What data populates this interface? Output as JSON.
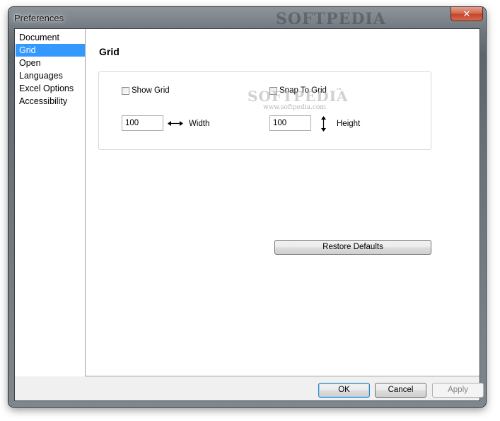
{
  "window": {
    "title": "Preferences",
    "close_glyph": "✕",
    "watermark": "SOFTPEDIA"
  },
  "sidebar": {
    "items": [
      {
        "label": "Document",
        "selected": false
      },
      {
        "label": "Grid",
        "selected": true
      },
      {
        "label": "Open",
        "selected": false
      },
      {
        "label": "Languages",
        "selected": false
      },
      {
        "label": "Excel Options",
        "selected": false
      },
      {
        "label": "Accessibility",
        "selected": false
      }
    ]
  },
  "page": {
    "title": "Grid",
    "show_grid": {
      "label": "Show Grid",
      "checked": false
    },
    "snap_to_grid": {
      "label": "Snap To Grid",
      "checked": false
    },
    "width": {
      "value": "100",
      "label": "Width",
      "icon": "horizontal-resize-arrow-icon"
    },
    "height": {
      "value": "100",
      "label": "Height",
      "icon": "vertical-resize-arrow-icon"
    },
    "watermark_text": "SOFTPEDIA",
    "watermark_tm": "™",
    "watermark_url": "www.softpedia.com",
    "restore_label": "Restore Defaults"
  },
  "footer": {
    "ok_label": "OK",
    "cancel_label": "Cancel",
    "apply_label": "Apply",
    "apply_enabled": false
  },
  "colors": {
    "selection": "#3399ff",
    "close_button": "#c4452a"
  }
}
